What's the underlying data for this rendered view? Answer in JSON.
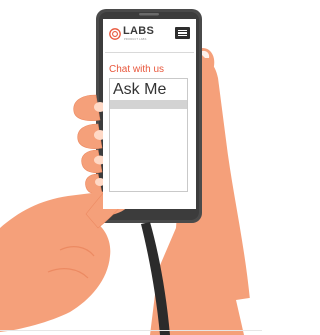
{
  "brand": {
    "logo_text": "LABS",
    "logo_subtext": "PRODUCT LABS",
    "accent_color": "#e8573c"
  },
  "header": {
    "menu_icon": "hamburger-menu-icon"
  },
  "chat": {
    "heading": "Chat with us",
    "input_value": "Ask Me"
  },
  "colors": {
    "phone_body": "#4a4a4a",
    "skin": "#f5a07a",
    "skin_shade": "#ec8a62",
    "sleeve": "#ffffff"
  }
}
